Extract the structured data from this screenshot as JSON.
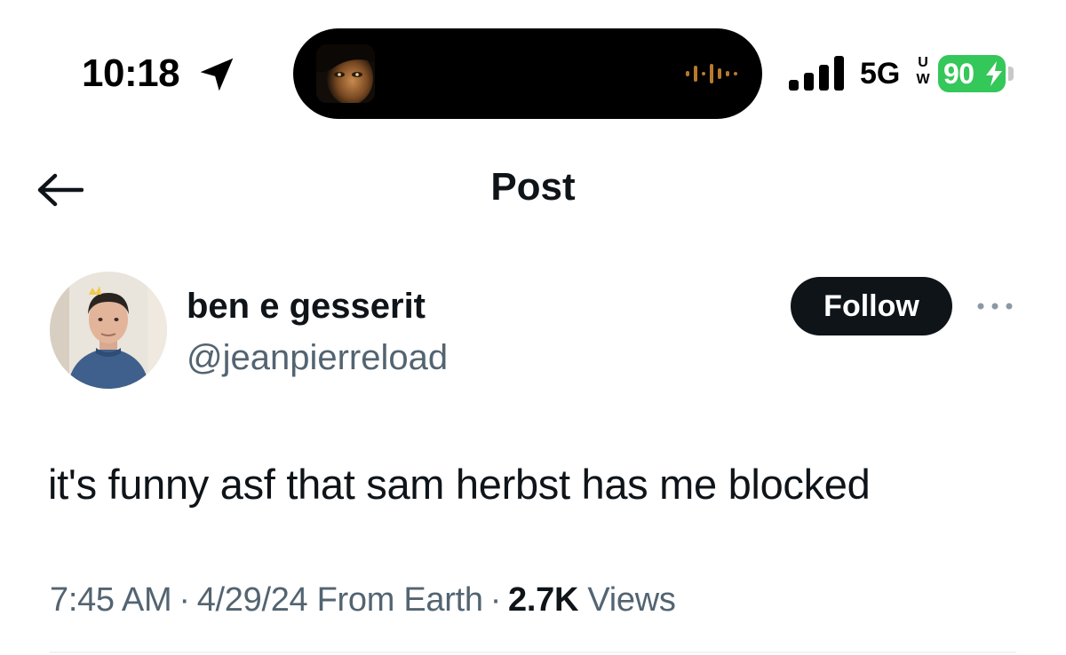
{
  "status_bar": {
    "time": "10:18",
    "network": "5G",
    "network_u": "U",
    "network_w": "W",
    "battery": "90",
    "accent_green": "#34c759"
  },
  "header": {
    "title": "Post",
    "back_icon": "back-arrow-icon"
  },
  "post": {
    "author": {
      "display_name": "ben e gesserit",
      "handle": "@jeanpierreload"
    },
    "follow_label": "Follow",
    "text": "it's funny asf that sam herbst has me blocked",
    "time": "7:45 AM",
    "date": "4/29/24",
    "source": "From Earth",
    "separator": "·",
    "views_count": "2.7K",
    "views_label": "Views"
  }
}
